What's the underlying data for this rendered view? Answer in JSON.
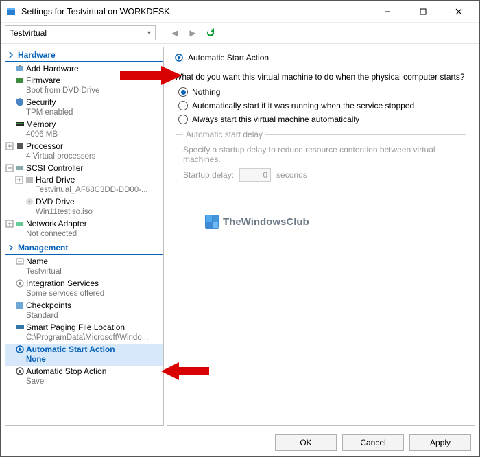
{
  "window": {
    "title": "Settings for Testvirtual on WORKDESK"
  },
  "toolbar": {
    "vm_selected": "Testvirtual"
  },
  "sidebar": {
    "sections": {
      "hardware": {
        "label": "Hardware",
        "add_hardware": "Add Hardware",
        "firmware": {
          "label": "Firmware",
          "sub": "Boot from DVD Drive"
        },
        "security": {
          "label": "Security",
          "sub": "TPM enabled"
        },
        "memory": {
          "label": "Memory",
          "sub": "4096 MB"
        },
        "processor": {
          "label": "Processor",
          "sub": "4 Virtual processors"
        },
        "scsi": {
          "label": "SCSI Controller"
        },
        "harddrive": {
          "label": "Hard Drive",
          "sub": "Testvirtual_AF68C3DD-DD00-..."
        },
        "dvd": {
          "label": "DVD Drive",
          "sub": "Win11testiso.iso"
        },
        "netadapter": {
          "label": "Network Adapter",
          "sub": "Not connected"
        }
      },
      "management": {
        "label": "Management",
        "name": {
          "label": "Name",
          "sub": "Testvirtual"
        },
        "integration": {
          "label": "Integration Services",
          "sub": "Some services offered"
        },
        "checkpoints": {
          "label": "Checkpoints",
          "sub": "Standard"
        },
        "smartpaging": {
          "label": "Smart Paging File Location",
          "sub": "C:\\ProgramData\\Microsoft\\Windo..."
        },
        "autostart": {
          "label": "Automatic Start Action",
          "sub": "None"
        },
        "autostop": {
          "label": "Automatic Stop Action",
          "sub": "Save"
        }
      }
    }
  },
  "pane": {
    "title": "Automatic Start Action",
    "question": "What do you want this virtual machine to do when the physical computer starts?",
    "radios": {
      "nothing": "Nothing",
      "auto_if": "Automatically start if it was running when the service stopped",
      "always": "Always start this virtual machine automatically"
    },
    "delay_group": {
      "legend": "Automatic start delay",
      "desc": "Specify a startup delay to reduce resource contention between virtual machines.",
      "label": "Startup delay:",
      "value": "0",
      "unit": "seconds"
    }
  },
  "watermark": "TheWindowsClub",
  "buttons": {
    "ok": "OK",
    "cancel": "Cancel",
    "apply": "Apply"
  }
}
